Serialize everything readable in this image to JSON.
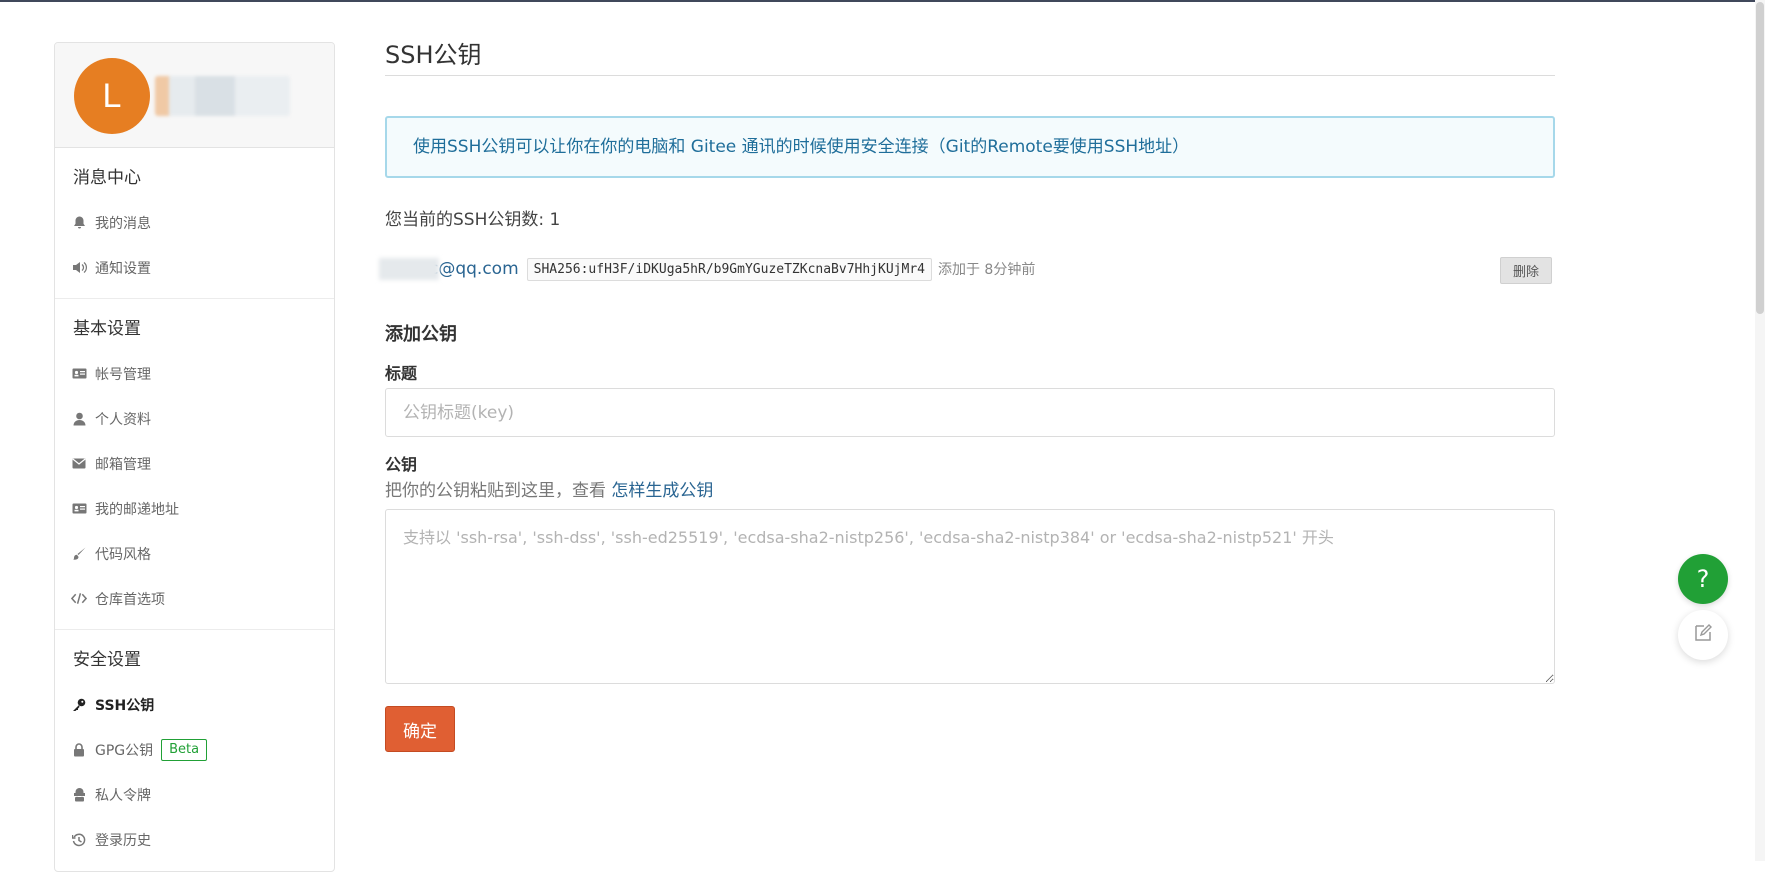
{
  "sidebar": {
    "avatar_letter": "L",
    "sections": [
      {
        "title": "消息中心",
        "items": [
          {
            "label": "我的消息",
            "icon": "bell-icon"
          },
          {
            "label": "通知设置",
            "icon": "speaker-icon"
          }
        ]
      },
      {
        "title": "基本设置",
        "items": [
          {
            "label": "帐号管理",
            "icon": "id-card-icon"
          },
          {
            "label": "个人资料",
            "icon": "user-icon"
          },
          {
            "label": "邮箱管理",
            "icon": "envelope-icon"
          },
          {
            "label": "我的邮递地址",
            "icon": "address-card-icon"
          },
          {
            "label": "代码风格",
            "icon": "brush-icon"
          },
          {
            "label": "仓库首选项",
            "icon": "code-icon"
          }
        ]
      },
      {
        "title": "安全设置",
        "items": [
          {
            "label": "SSH公钥",
            "icon": "key-icon",
            "active": true
          },
          {
            "label": "GPG公钥",
            "icon": "lock-icon",
            "badge": "Beta"
          },
          {
            "label": "私人令牌",
            "icon": "token-icon"
          },
          {
            "label": "登录历史",
            "icon": "history-icon"
          }
        ]
      }
    ]
  },
  "main": {
    "title": "SSH公钥",
    "info": "使用SSH公钥可以让你在你的电脑和 Gitee 通讯的时候使用安全连接（Git的Remote要使用SSH地址）",
    "count_text": "您当前的SSH公钥数: 1",
    "key": {
      "email": "c@qq.com",
      "fingerprint": "SHA256:ufH3F/iDKUga5hR/b9GmYGuzeTZKcnaBv7HhjKUjMr4",
      "added": "添加于 8分钟前",
      "delete_label": "删除"
    },
    "form": {
      "heading": "添加公钥",
      "title_label": "标题",
      "title_placeholder": "公钥标题(key)",
      "key_label": "公钥",
      "hint_prefix": "把你的公钥粘贴到这里，查看 ",
      "hint_link": "怎样生成公钥",
      "key_placeholder": "支持以 'ssh-rsa', 'ssh-dss', 'ssh-ed25519', 'ecdsa-sha2-nistp256', 'ecdsa-sha2-nistp384' or 'ecdsa-sha2-nistp521' 开头",
      "submit_label": "确定"
    }
  },
  "float": {
    "help_label": "?"
  },
  "colors": {
    "accent": "#e05f33",
    "help": "#21a036",
    "avatar": "#e67e22",
    "info_text": "#1f6e9a"
  }
}
